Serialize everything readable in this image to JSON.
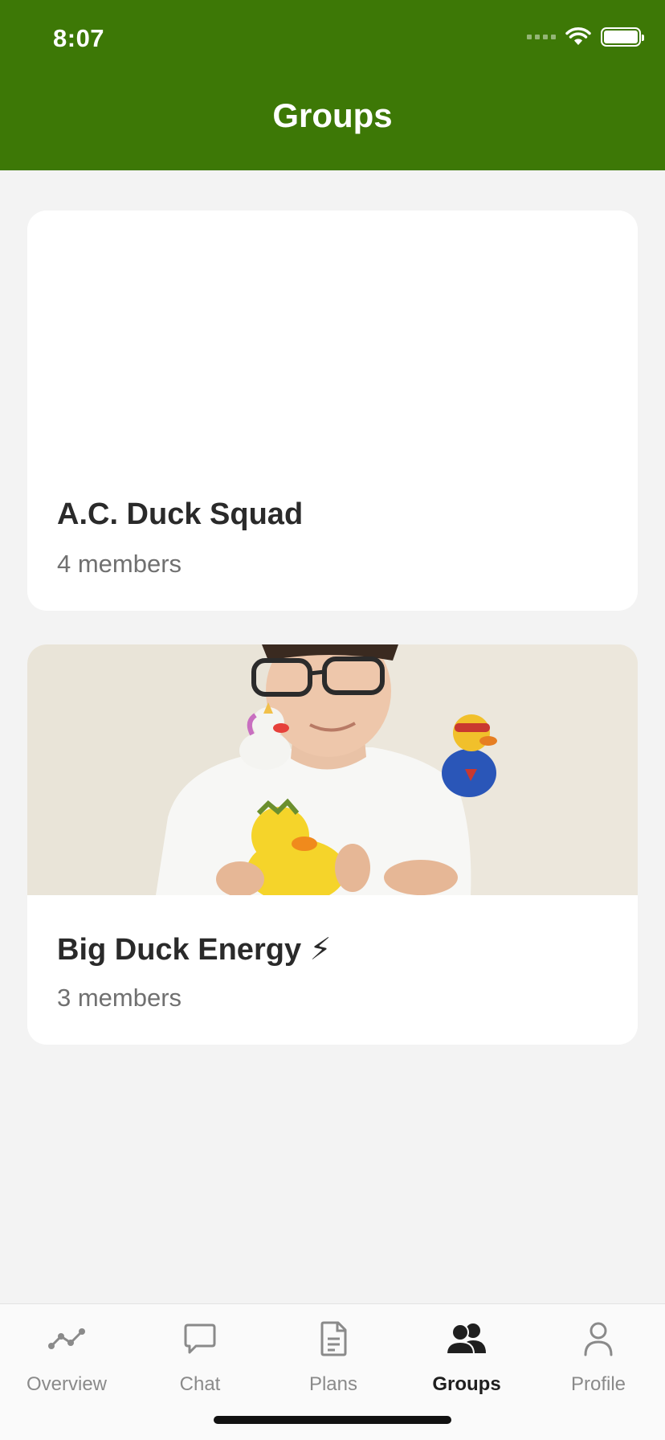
{
  "status_bar": {
    "time": "8:07"
  },
  "header": {
    "title": "Groups"
  },
  "groups": [
    {
      "name": "A.C. Duck Squad",
      "members": "4 members"
    },
    {
      "name": "Big Duck Energy ⚡",
      "members": "3 members"
    }
  ],
  "tabbar": {
    "items": [
      {
        "label": "Overview",
        "icon": "overview-icon"
      },
      {
        "label": "Chat",
        "icon": "chat-icon"
      },
      {
        "label": "Plans",
        "icon": "plans-icon"
      },
      {
        "label": "Groups",
        "icon": "groups-icon",
        "active": true
      },
      {
        "label": "Profile",
        "icon": "profile-icon"
      }
    ]
  },
  "colors": {
    "header": "#3d7806",
    "background": "#f3f3f3",
    "active_tab": "#1f1f1f",
    "inactive_tab": "#8a8a8a"
  }
}
